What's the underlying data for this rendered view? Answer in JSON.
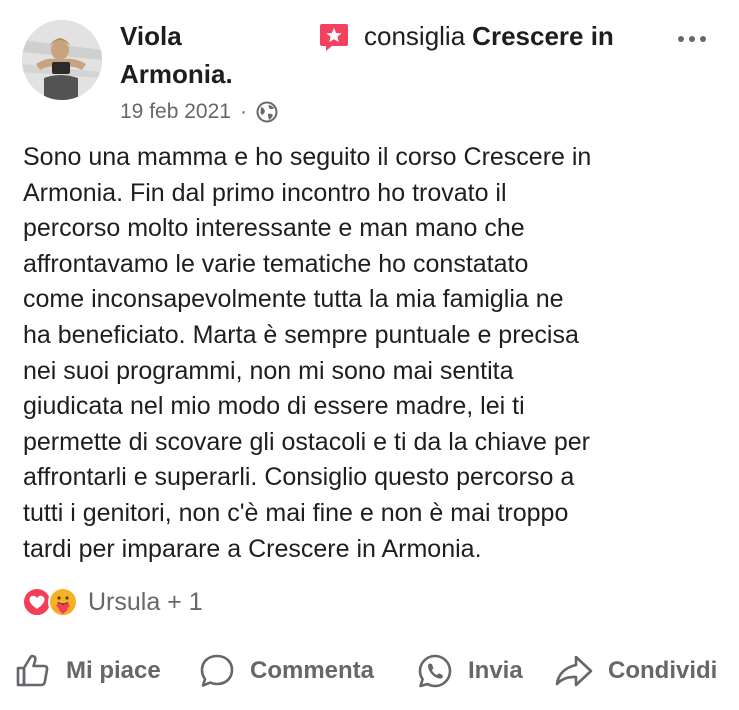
{
  "post": {
    "author_line1": "Viola",
    "author_line2": "Armonia.",
    "recommends_text": "consiglia",
    "page_name": "Crescere in",
    "date": "19 feb 2021",
    "separator": "·",
    "privacy_icon": "globe-icon",
    "more_icon": "more-options-icon",
    "text_lines": [
      "Sono una mamma e ho seguito il corso Crescere in",
      "Armonia. Fin dal primo incontro ho trovato il",
      "percorso molto interessante e man mano che",
      "affrontavamo le varie tematiche ho constatato",
      "come inconsapevolmente tutta la mia famiglia ne",
      "ha beneficiato. Marta è sempre puntuale e precisa",
      "nei suoi programmi, non mi sono mai sentita",
      "giudicata nel mio modo di essere madre, lei ti",
      "permette di scovare gli ostacoli e ti da la chiave per",
      "affrontarli e superarli. Consiglio questo percorso a",
      "tutti i genitori, non c'è mai fine e non è mai troppo",
      "tardi per imparare a Crescere in Armonia."
    ]
  },
  "reactions": {
    "icons": [
      "love-reaction-icon",
      "care-reaction-icon"
    ],
    "text": "Ursula + 1"
  },
  "actions": {
    "like": "Mi piace",
    "comment": "Commenta",
    "send": "Invia",
    "share": "Condividi"
  },
  "colors": {
    "text_primary": "#1c1e21",
    "text_secondary": "#65676b",
    "recommend_badge": "#f3425f",
    "love_reaction": "#f33e58",
    "care_reaction": "#f7b125"
  }
}
